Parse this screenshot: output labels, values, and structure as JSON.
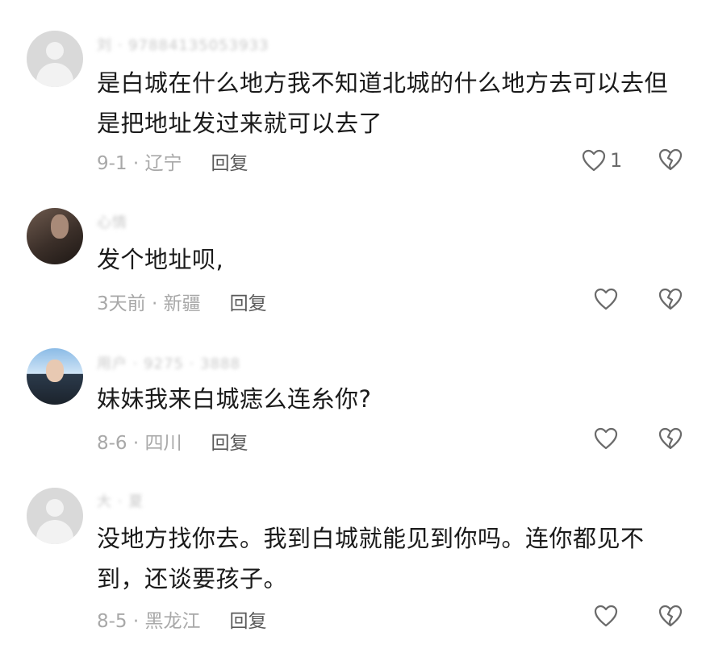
{
  "comments": [
    {
      "username": "刘 · 97884135053933",
      "text": "是白城在什么地方我不知道北城的什么地方去可以去但是把地址发过来就可以去了",
      "date_location": "9-1 · 辽宁",
      "reply_label": "回复",
      "like_count": "1"
    },
    {
      "username": "心情",
      "text": "发个地址呗,",
      "date_location": "3天前 · 新疆",
      "reply_label": "回复",
      "like_count": ""
    },
    {
      "username": "用户 · 9275 · 3888",
      "text": "妹妹我来白城痣么连糸你?",
      "date_location": "8-6 · 四川",
      "reply_label": "回复",
      "like_count": ""
    },
    {
      "username": "大 · 夏",
      "text": "没地方找你去。我到白城就能见到你吗。连你都见不到，还谈要孩子。",
      "date_location": "8-5 · 黑龙江",
      "reply_label": "回复",
      "like_count": ""
    }
  ],
  "icons": {
    "like": "heart-outline-icon",
    "dislike": "broken-heart-icon"
  },
  "colors": {
    "text": "#1a1a1a",
    "meta": "#a8a8a8",
    "icon": "#6a6a6a"
  }
}
